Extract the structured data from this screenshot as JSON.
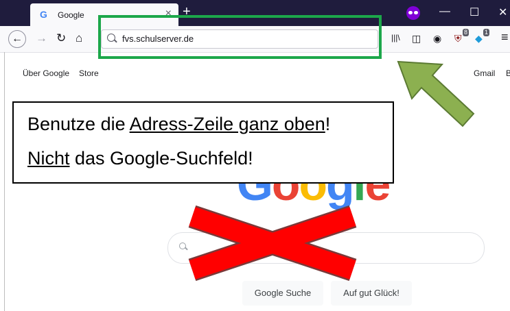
{
  "browser": {
    "tab_title": "Google",
    "tab_favicon": "G",
    "tab_close": "×",
    "new_tab": "+",
    "window_controls": {
      "minimize": "—",
      "maximize": "☐",
      "close": "✕"
    },
    "url": "fvs.schulserver.de",
    "badges": {
      "ublock": "8",
      "ext": "1"
    },
    "icons": {
      "library": "|||\\",
      "sidebar": "◫",
      "account": "◉",
      "menu": "≡"
    }
  },
  "google": {
    "top_links": {
      "about": "Über Google",
      "store": "Store",
      "gmail": "Gmail",
      "cut": "B"
    },
    "logo": "Google",
    "buttons": {
      "search": "Google Suche",
      "lucky": "Auf gut Glück!"
    },
    "logo_colors": [
      "#4285F4",
      "#EA4335",
      "#FBBC05",
      "#4285F4",
      "#34A853",
      "#EA4335"
    ]
  },
  "callout": {
    "line1_a": "Benutze die ",
    "line1_b": "Adress-Zeile ganz oben",
    "line1_c": "!",
    "line2_a": "Nicht",
    "line2_b": " das Google-Suchfeld!"
  },
  "colors": {
    "highlight": "#1ca74a",
    "arrow": "#8cb050",
    "cross": "#ff0000"
  }
}
